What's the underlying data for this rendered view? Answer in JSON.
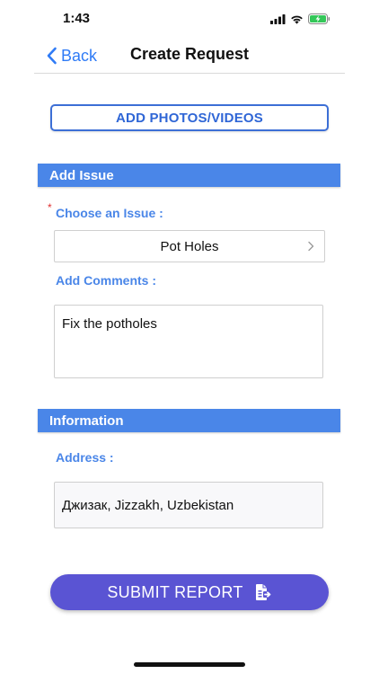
{
  "status_bar": {
    "time": "1:43"
  },
  "nav": {
    "back_label": "Back",
    "title": "Create Request"
  },
  "add_media_label": "ADD PHOTOS/VIDEOS",
  "sections": {
    "add_issue": "Add Issue",
    "information": "Information"
  },
  "issue": {
    "required_mark": "*",
    "label": "Choose an Issue :",
    "selected_value": "Pot Holes",
    "comments_label": "Add Comments :",
    "comments_value": "Fix the potholes"
  },
  "information": {
    "address_label": "Address :",
    "address_value": "Джизак, Jizzakh, Uzbekistan"
  },
  "submit_label": "SUBMIT REPORT",
  "colors": {
    "accent_blue": "#4a86e8",
    "back_blue": "#2f7bf6",
    "submit_purple": "#5a54d3",
    "required_red": "#e03030",
    "battery_green": "#34c759"
  },
  "icons": {
    "back": "chevron-left-icon",
    "select": "chevron-right-icon",
    "submit": "document-arrow-icon",
    "signal": "cellular-signal-icon",
    "wifi": "wifi-icon",
    "battery": "battery-charging-icon"
  }
}
